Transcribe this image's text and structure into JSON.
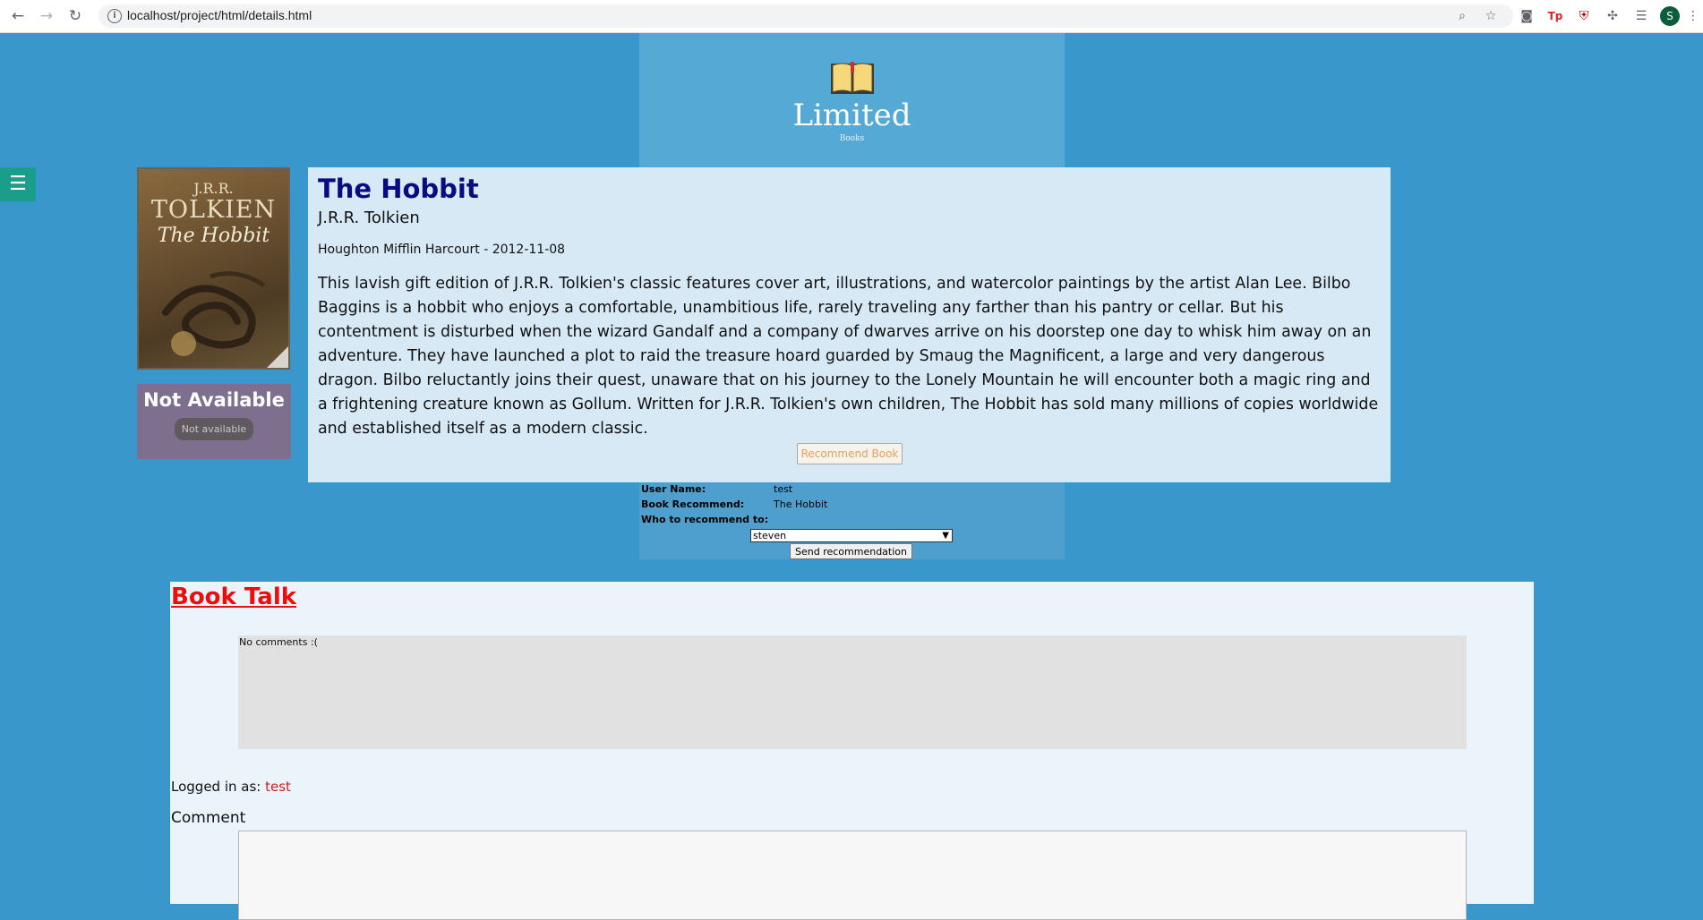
{
  "browser": {
    "url": "localhost/project/html/details.html",
    "avatar_letter": "S"
  },
  "logo": {
    "title": "Limited",
    "subtitle": "Books"
  },
  "menu": {
    "toggle_glyph": "☰"
  },
  "cover": {
    "line1": "J.R.R.",
    "line2": "TOLKIEN",
    "line3": "The Hobbit"
  },
  "availability": {
    "title": "Not Available",
    "button_label": "Not available"
  },
  "book": {
    "title": "The Hobbit",
    "author": "J.R.R. Tolkien",
    "publisher_date": "Houghton Mifflin Harcourt - 2012-11-08",
    "description": "This lavish gift edition of J.R.R. Tolkien's classic features cover art, illustrations, and watercolor paintings by the artist Alan Lee. Bilbo Baggins is a hobbit who enjoys a comfortable, unambitious life, rarely traveling any farther than his pantry or cellar. But his contentment is disturbed when the wizard Gandalf and a company of dwarves arrive on his doorstep one day to whisk him away on an adventure. They have launched a plot to raid the treasure hoard guarded by Smaug the Magnificent, a large and very dangerous dragon. Bilbo reluctantly joins their quest, unaware that on his journey to the Lonely Mountain he will encounter both a magic ring and a frightening creature known as Gollum. Written for J.R.R. Tolkien's own children, The Hobbit has sold many millions of copies worldwide and established itself as a modern classic.",
    "recommend_label": "Recommend Book"
  },
  "recommend_form": {
    "user_name_label": "User Name:",
    "user_name_value": "test",
    "book_label": "Book Recommend:",
    "book_value": "The Hobbit",
    "who_label": "Who to recommend to:",
    "selected_recipient": "steven",
    "send_label": "Send recommendation"
  },
  "book_talk": {
    "title": "Book Talk",
    "no_comments": "No comments :(",
    "logged_in_label": "Logged in as:",
    "logged_in_user": "test",
    "comment_label": "Comment"
  },
  "colors": {
    "page_bg": "#3a97cc",
    "title_blue": "#0a0a82",
    "book_talk_red": "#ee0d0d"
  }
}
